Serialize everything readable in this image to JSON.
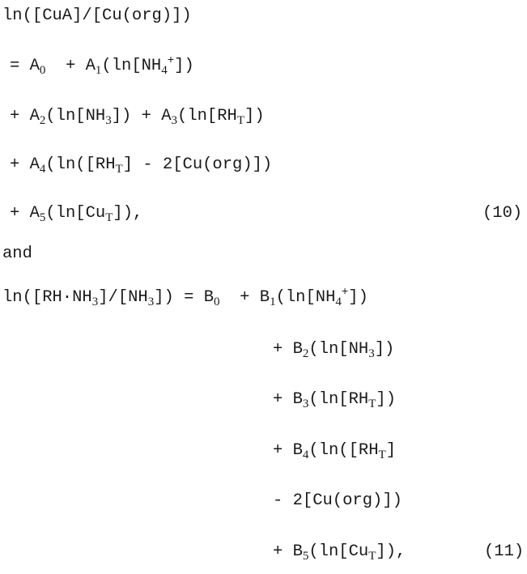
{
  "equation_10": {
    "lines": [
      [
        {
          "t": "ln([CuA]/[Cu(org)])"
        }
      ],
      [
        {
          "t": "= A"
        },
        {
          "sub": "0"
        },
        {
          "t": "  + A"
        },
        {
          "sub": "1"
        },
        {
          "t": "(ln[NH"
        },
        {
          "sub": "4"
        },
        {
          "sup": "+"
        },
        {
          "t": "])"
        }
      ],
      [
        {
          "t": "+ A"
        },
        {
          "sub": "2"
        },
        {
          "t": "(ln[NH"
        },
        {
          "sub": "3"
        },
        {
          "t": "]) + A"
        },
        {
          "sub": "3"
        },
        {
          "t": "(ln[RH"
        },
        {
          "sub": "T"
        },
        {
          "t": "])"
        }
      ],
      [
        {
          "t": "+ A"
        },
        {
          "sub": "4"
        },
        {
          "t": "(ln([RH"
        },
        {
          "sub": "T"
        },
        {
          "t": "] - 2[Cu(org)])"
        }
      ],
      [
        {
          "t": "+ A"
        },
        {
          "sub": "5"
        },
        {
          "t": "(ln[Cu"
        },
        {
          "sub": "T"
        },
        {
          "t": "]),"
        }
      ]
    ],
    "number": "(10)"
  },
  "connector": "and",
  "equation_11": {
    "lines": [
      [
        {
          "t": "ln([RH·NH"
        },
        {
          "sub": "3"
        },
        {
          "t": "]/[NH"
        },
        {
          "sub": "3"
        },
        {
          "t": "]) = B"
        },
        {
          "sub": "0"
        },
        {
          "t": "  + B"
        },
        {
          "sub": "1"
        },
        {
          "t": "(ln[NH"
        },
        {
          "sub": "4"
        },
        {
          "sup": "+"
        },
        {
          "t": "])"
        }
      ],
      [
        {
          "t": "+ B"
        },
        {
          "sub": "2"
        },
        {
          "t": "(ln[NH"
        },
        {
          "sub": "3"
        },
        {
          "t": "])"
        }
      ],
      [
        {
          "t": "+ B"
        },
        {
          "sub": "3"
        },
        {
          "t": "(ln[RH"
        },
        {
          "sub": "T"
        },
        {
          "t": "])"
        }
      ],
      [
        {
          "t": "+ B"
        },
        {
          "sub": "4"
        },
        {
          "t": "(ln([RH"
        },
        {
          "sub": "T"
        },
        {
          "t": "]"
        }
      ],
      [
        {
          "t": "- 2[Cu(org)])"
        }
      ],
      [
        {
          "t": "+ B"
        },
        {
          "sub": "5"
        },
        {
          "t": "(ln[Cu"
        },
        {
          "sub": "T"
        },
        {
          "t": "]),"
        }
      ]
    ],
    "number": "(11)"
  }
}
